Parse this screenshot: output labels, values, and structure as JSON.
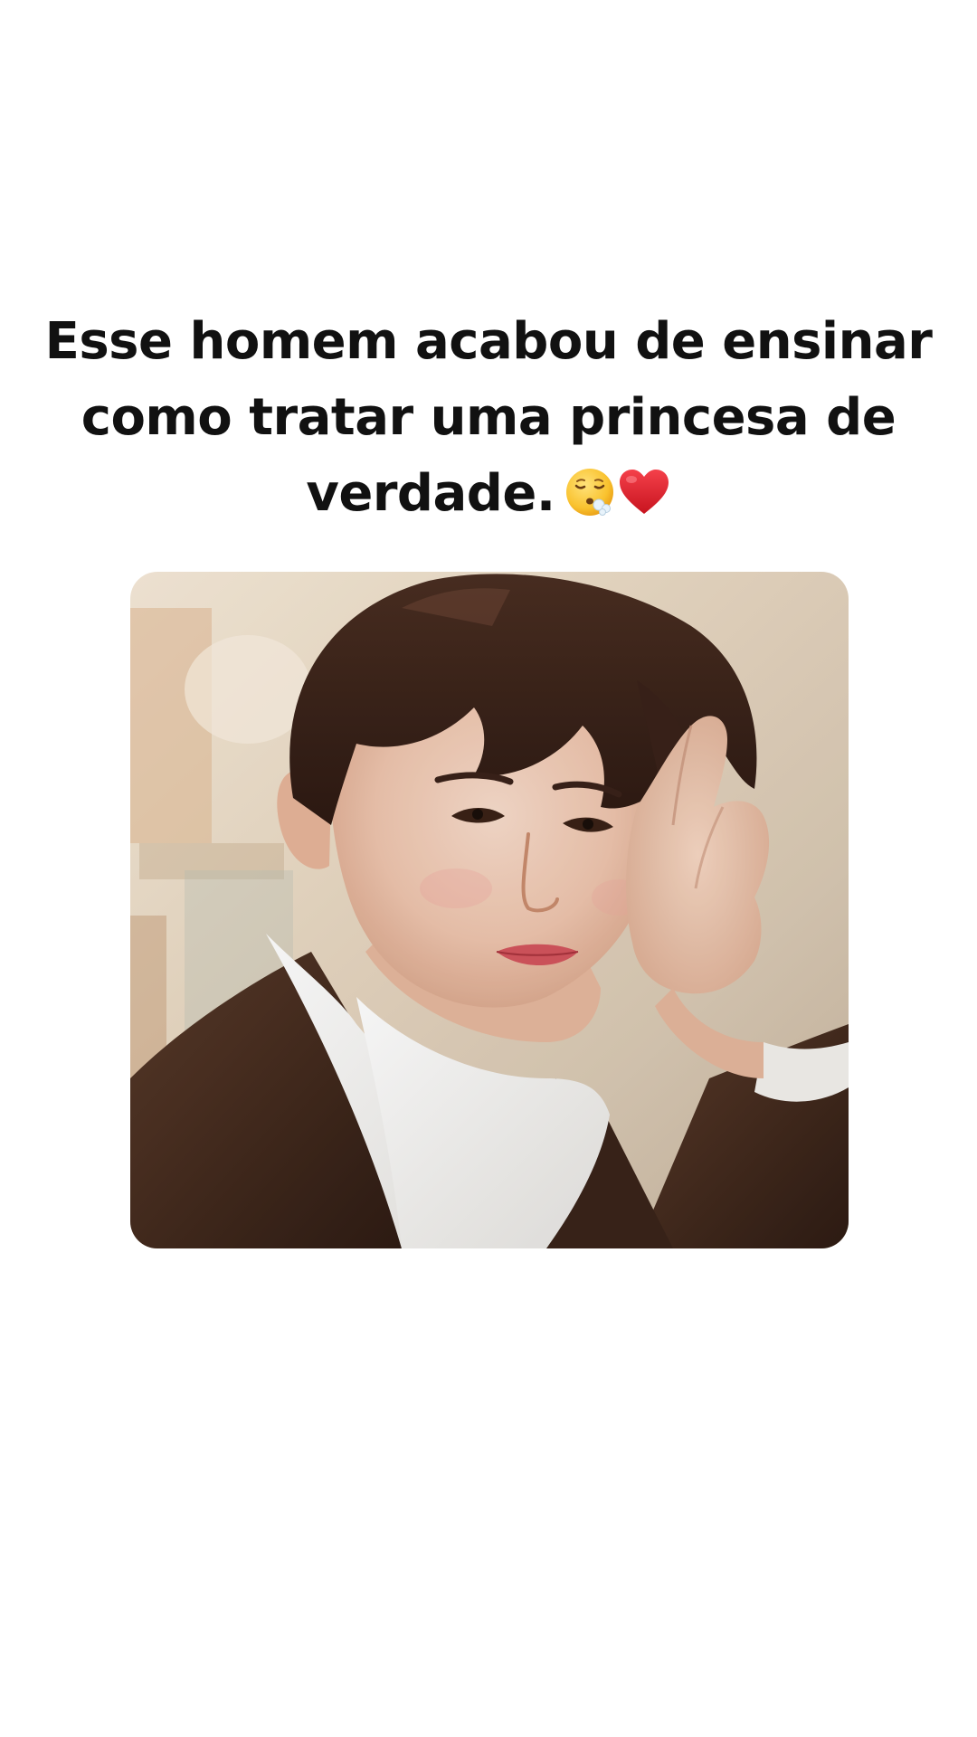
{
  "post": {
    "caption_lines": [
      "Esse homem acabou de ensinar",
      "como tratar uma princesa de",
      "verdade."
    ],
    "caption_emojis": [
      "face-exhaling-emoji",
      "red-heart-emoji"
    ]
  },
  "media": {
    "type": "video-frame",
    "subject": "photo"
  },
  "colors": {
    "background": "#ffffff",
    "text": "#111111",
    "heart": "#e0242f"
  }
}
